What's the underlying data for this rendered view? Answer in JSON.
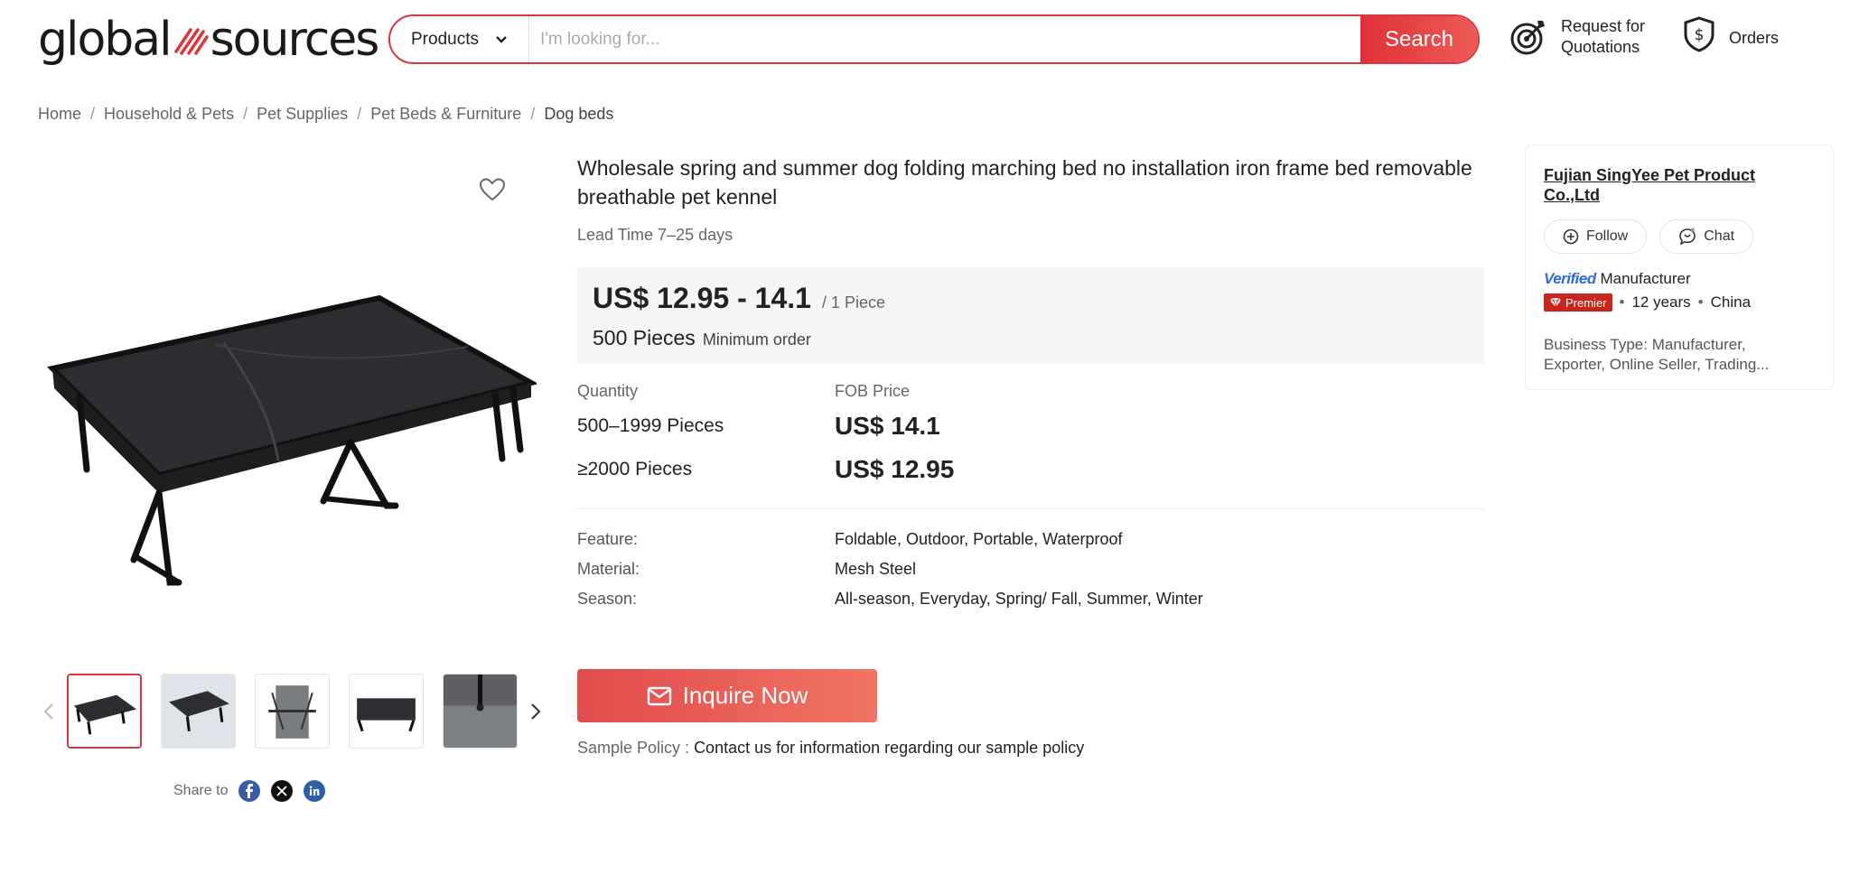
{
  "header": {
    "logo_left": "global",
    "logo_right": "sources",
    "search_category": "Products",
    "search_placeholder": "I'm looking for...",
    "search_button": "Search",
    "rfq_line1": "Request for",
    "rfq_line2": "Quotations",
    "orders": "Orders"
  },
  "breadcrumb": [
    "Home",
    "Household & Pets",
    "Pet Supplies",
    "Pet Beds & Furniture",
    "Dog beds"
  ],
  "product": {
    "title": "Wholesale spring and summer dog folding marching bed no installation iron frame bed removable breathable pet kennel",
    "lead_time": "Lead Time 7–25 days",
    "price_range": "US$ 12.95 - 14.1",
    "price_unit": "/ 1 Piece",
    "moq": "500 Pieces",
    "moq_label": "Minimum order",
    "tier_header_qty": "Quantity",
    "tier_header_price": "FOB Price",
    "tiers": [
      {
        "qty": "500–1999 Pieces",
        "price": "US$ 14.1"
      },
      {
        "qty": "≥2000 Pieces",
        "price": "US$ 12.95"
      }
    ],
    "specs": [
      {
        "label": "Feature:",
        "value": "Foldable, Outdoor, Portable, Waterproof"
      },
      {
        "label": "Material:",
        "value": "Mesh Steel"
      },
      {
        "label": "Season:",
        "value": "All-season, Everyday, Spring/ Fall, Summer, Winter"
      }
    ],
    "inquire_button": "Inquire Now",
    "sample_label": "Sample Policy : ",
    "sample_value": "Contact us for information regarding our sample policy"
  },
  "gallery": {
    "share_label": "Share to"
  },
  "supplier": {
    "name": "Fujian SingYee Pet Product Co.,Ltd",
    "follow": "Follow",
    "chat": "Chat",
    "verified_word": "Verified",
    "verified_type": "Manufacturer",
    "premier": "Premier",
    "years": "12 years",
    "country": "China",
    "business_type": "Business Type: Manufacturer, Exporter, Online Seller, Trading..."
  },
  "colors": {
    "accent": "#d9363e",
    "price_box": "#f5f5f5",
    "verified": "#2a6cd6"
  }
}
